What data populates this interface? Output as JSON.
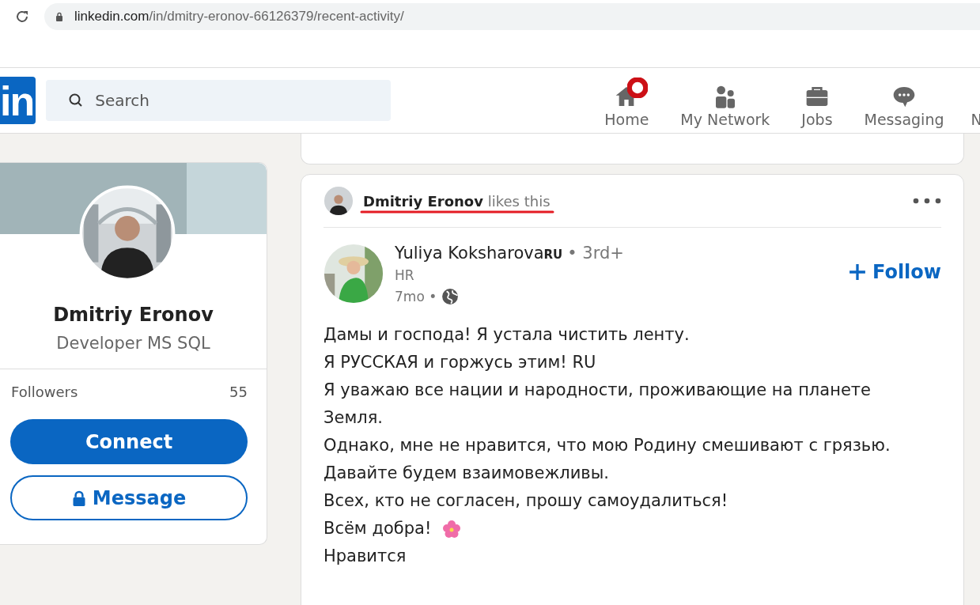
{
  "browser": {
    "url_host": "linkedin.com",
    "url_path": "/in/dmitry-eronov-66126379/recent-activity/"
  },
  "header": {
    "logo": "in",
    "search": {
      "placeholder": "Search"
    },
    "nav": [
      {
        "label": "Home",
        "kind": "home",
        "notification": true
      },
      {
        "label": "My Network",
        "kind": "network",
        "notification": false
      },
      {
        "label": "Jobs",
        "kind": "jobs",
        "notification": false
      },
      {
        "label": "Messaging",
        "kind": "messaging",
        "notification": false
      },
      {
        "label": "N",
        "kind": "cut",
        "notification": false
      }
    ]
  },
  "profile": {
    "name": "Dmitriy Eronov",
    "headline": "Developer MS SQL",
    "followers_label": "Followers",
    "followers_count": "55",
    "buttons": [
      {
        "label": "Connect",
        "kind": "primary"
      },
      {
        "label": "Message",
        "kind": "locked"
      }
    ]
  },
  "post": {
    "activity": {
      "actor": "Dmitriy Eronov",
      "action": "likes this",
      "underlined": true
    },
    "author": {
      "name": "Yuliya Koksharova",
      "name_suffix": "RU",
      "degree": "• 3rd+",
      "title": "HR",
      "time": "7mo •"
    },
    "follow": "Follow",
    "lines": [
      {
        "text": "Дамы и господа! Я устала чистить ленту.",
        "flower": false
      },
      {
        "text": "Я РУССКАЯ и горжусь этим! RU",
        "flower": false
      },
      {
        "text": "Я уважаю все нации и народности, проживающие на планете Земля.",
        "flower": false
      },
      {
        "text": "Однако, мне не нравится, что мою Родину смешивают с грязью.",
        "flower": false
      },
      {
        "text": "Давайте будем взаимовежливы.",
        "flower": false
      },
      {
        "text": "Всех, кто не согласен, прошу самоудалиться!",
        "flower": false
      },
      {
        "text": "Всём добра!",
        "flower": true
      },
      {
        "text": "Нравится",
        "flower": false
      }
    ]
  }
}
